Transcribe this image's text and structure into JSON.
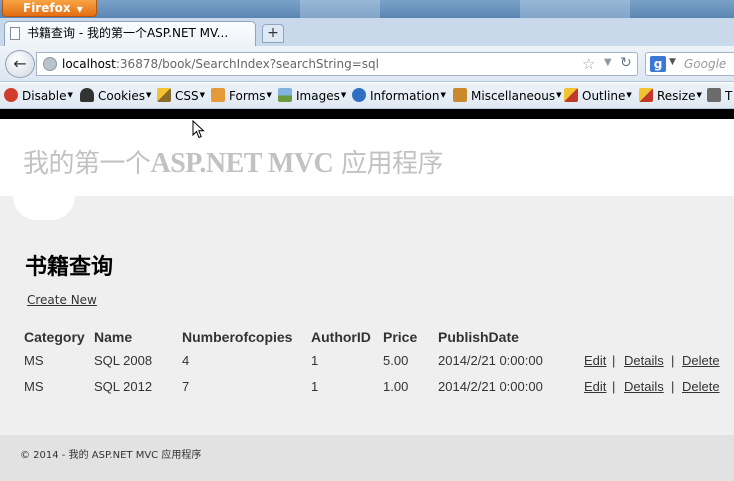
{
  "browser": {
    "app_button": "Firefox",
    "tab_title": "书籍查询 - 我的第一个ASP.NET MV...",
    "new_tab": "+",
    "url_host": "localhost",
    "url_rest": ":36878/book/SearchIndex?searchString=sql",
    "search_placeholder": "Google",
    "search_engine_letter": "g"
  },
  "webdev_toolbar": {
    "items": [
      "Disable",
      "Cookies",
      "CSS",
      "Forms",
      "Images",
      "Information",
      "Miscellaneous",
      "Outline",
      "Resize",
      "T"
    ]
  },
  "site": {
    "title_prefix": "我的第一个",
    "title_asp": "ASP.NET MVC",
    "title_suffix": " 应用程序"
  },
  "page": {
    "heading": "书籍查询",
    "create_new": "Create New",
    "columns": [
      "Category",
      "Name",
      "Numberofcopies",
      "AuthorID",
      "Price",
      "PublishDate"
    ],
    "rows": [
      {
        "category": "MS",
        "name": "SQL 2008",
        "copies": "4",
        "author_id": "1",
        "price": "5.00",
        "publish_date": "2014/2/21 0:00:00"
      },
      {
        "category": "MS",
        "name": "SQL 2012",
        "copies": "7",
        "author_id": "1",
        "price": "1.00",
        "publish_date": "2014/2/21 0:00:00"
      }
    ],
    "actions": {
      "edit": "Edit",
      "details": "Details",
      "delete": "Delete",
      "separator": "|"
    }
  },
  "footer": {
    "text": "© 2014 - 我的 ASP.NET MVC 应用程序"
  },
  "colors": {
    "firefox_orange": "#e46d12",
    "page_background": "#efefef",
    "title_gray": "#c2c2c2",
    "footer_background": "#e2e2e2"
  }
}
